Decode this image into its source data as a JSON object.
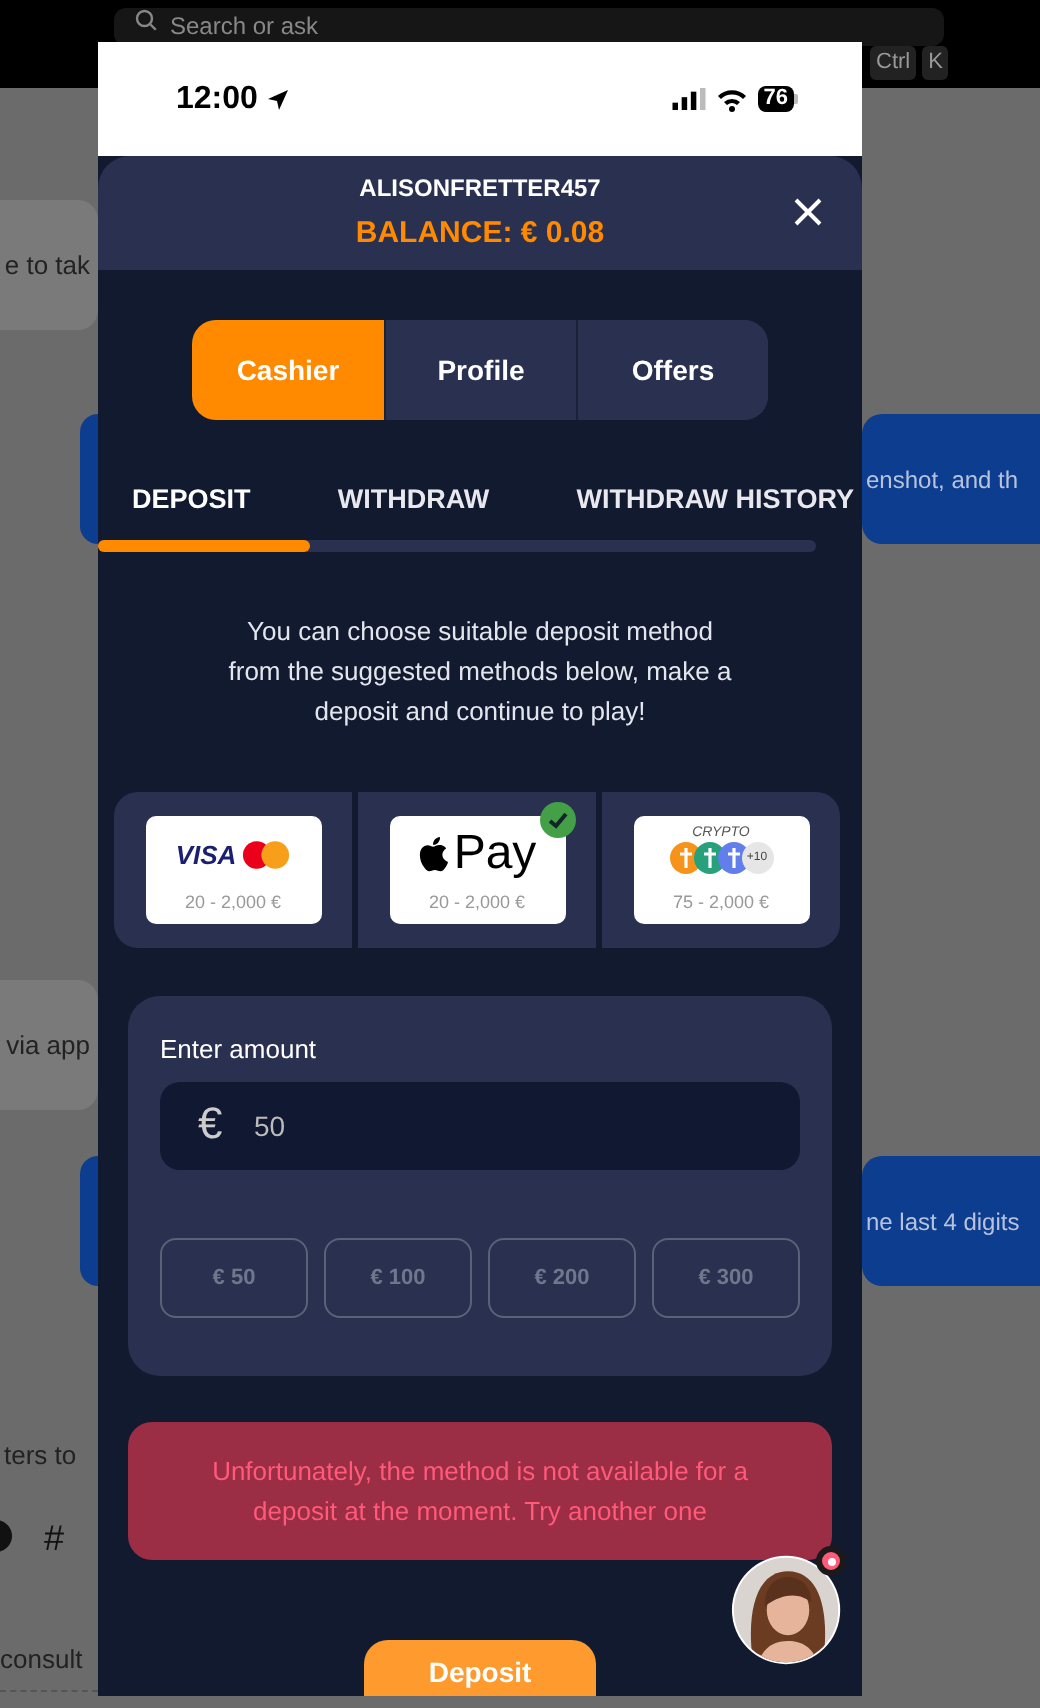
{
  "background": {
    "search": {
      "placeholder": "Search or ask"
    },
    "shortcut_keys": [
      "Ctrl",
      "K"
    ],
    "fragments": [
      {
        "kind": "grey-bubble",
        "text": "e to tak"
      },
      {
        "kind": "blue-bubble",
        "text": "enshot, and th"
      },
      {
        "kind": "grey-bubble",
        "text": "via app"
      },
      {
        "kind": "blue-bubble",
        "text": "ne last 4 digits"
      },
      {
        "kind": "plain",
        "text": "ters to"
      },
      {
        "kind": "toolbar",
        "text": "#"
      },
      {
        "kind": "dashed",
        "text": "consult"
      }
    ]
  },
  "status_bar": {
    "time": "12:00",
    "battery": "76"
  },
  "header": {
    "username": "ALISONFRETTER457",
    "balance": "BALANCE: € 0.08"
  },
  "nav_tabs": [
    {
      "label": "Cashier",
      "selected": true
    },
    {
      "label": "Profile",
      "selected": false
    },
    {
      "label": "Offers",
      "selected": false
    }
  ],
  "sub_tabs": [
    {
      "label": "DEPOSIT",
      "selected": true
    },
    {
      "label": "WITHDRAW",
      "selected": false
    },
    {
      "label": "WITHDRAW HISTORY",
      "selected": false
    }
  ],
  "description": "You can choose suitable deposit method from the suggested methods below, make a deposit and continue to play!",
  "methods": [
    {
      "kind": "cards",
      "logo_text": "VISA",
      "range": "20 - 2,000 €",
      "selected": false
    },
    {
      "kind": "applepay",
      "logo_text": "Pay",
      "range": "20 - 2,000 €",
      "selected": true
    },
    {
      "kind": "crypto",
      "logo_text": "CRYPTO",
      "extra": "+10",
      "range": "75 - 2,000 €",
      "selected": false
    }
  ],
  "amount": {
    "label": "Enter amount",
    "currency": "€",
    "value": "50",
    "presets": [
      "€ 50",
      "€ 100",
      "€ 200",
      "€ 300"
    ]
  },
  "error": "Unfortunately, the method is not available for a deposit at the moment. Try another one",
  "deposit_button": "Deposit",
  "chat_avatar": {
    "notification": true
  }
}
